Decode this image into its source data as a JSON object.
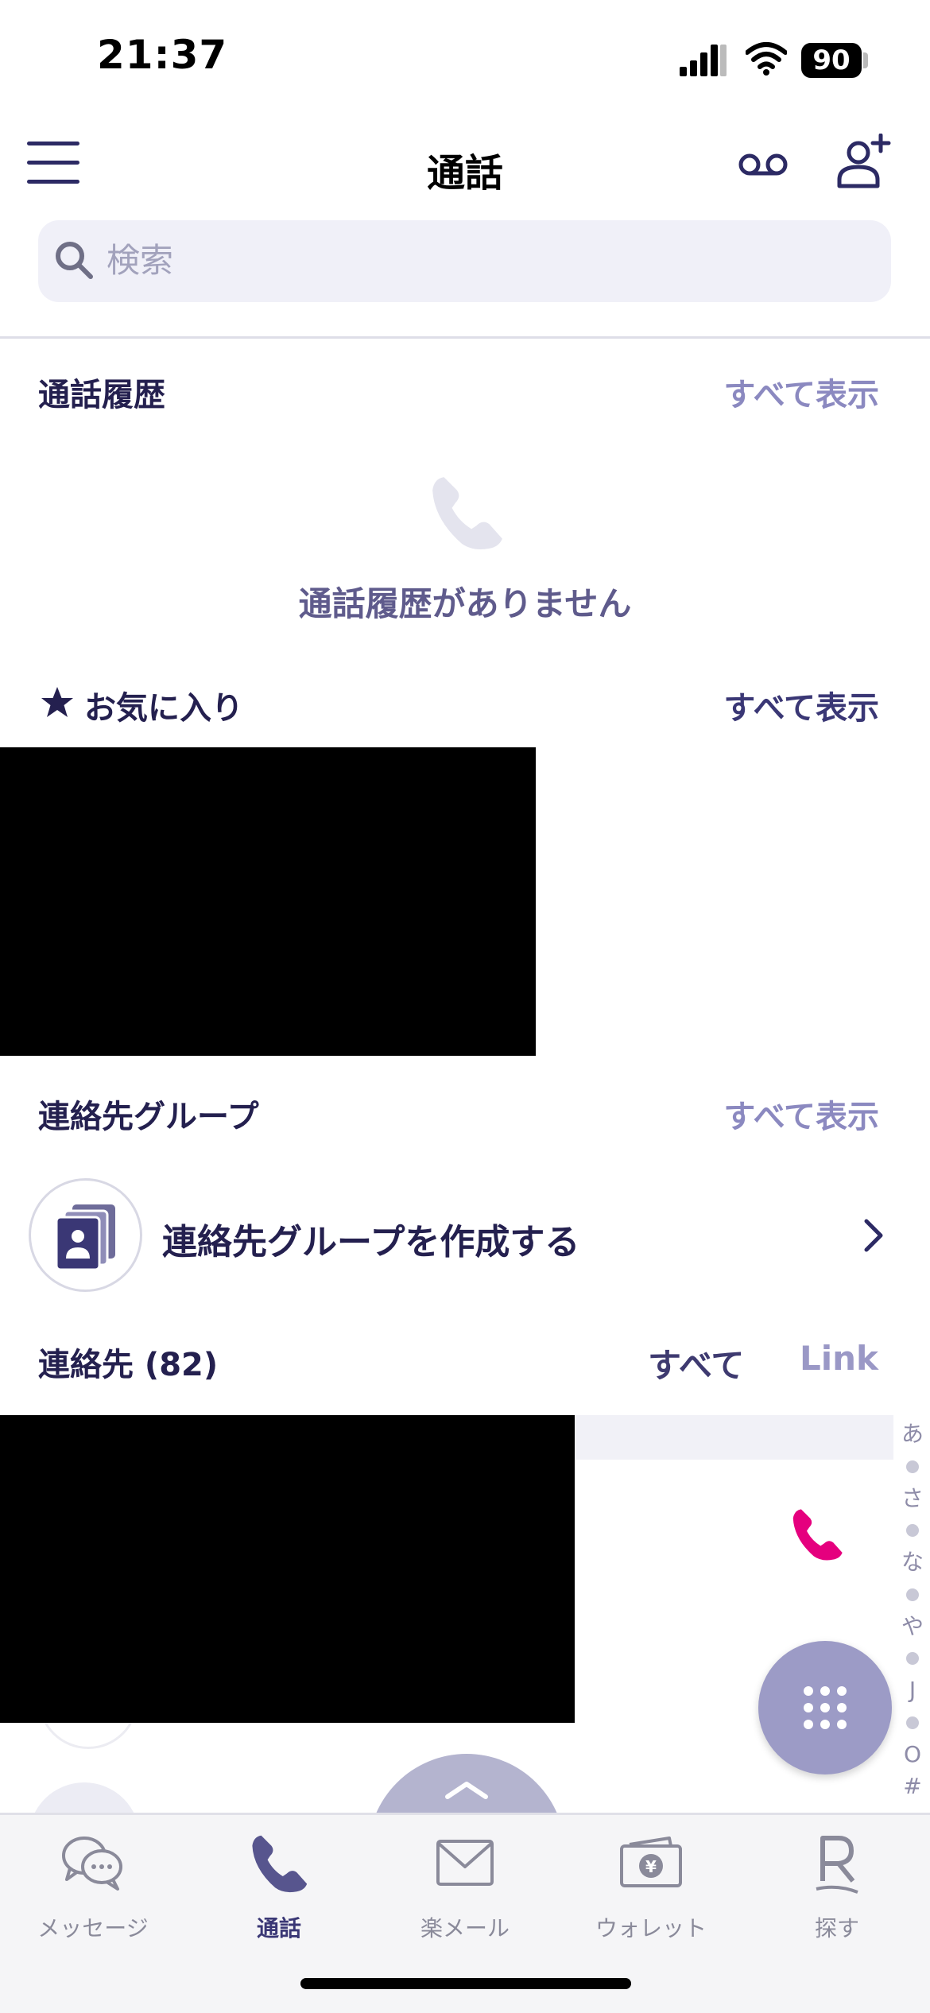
{
  "status_bar": {
    "time": "21:37",
    "battery": "90"
  },
  "header": {
    "title": "通話"
  },
  "search": {
    "placeholder": "検索"
  },
  "call_history": {
    "title": "通話履歴",
    "show_all": "すべて表示",
    "empty_message": "通話履歴がありません"
  },
  "favorites": {
    "title": "お気に入り",
    "show_all": "すべて表示"
  },
  "contact_groups": {
    "title": "連絡先グループ",
    "show_all": "すべて表示",
    "create_label": "連絡先グループを作成する"
  },
  "contacts": {
    "title": "連絡先 (82)",
    "tabs": [
      "すべて",
      "Link"
    ],
    "index": [
      "あ",
      "さ",
      "な",
      "や",
      "J",
      "O",
      "#"
    ]
  },
  "bottom_nav": {
    "items": [
      {
        "label": "メッセージ",
        "icon": "message-bubbles-icon",
        "active": false
      },
      {
        "label": "通話",
        "icon": "phone-icon",
        "active": true
      },
      {
        "label": "楽メール",
        "icon": "mail-icon",
        "active": false
      },
      {
        "label": "ウォレット",
        "icon": "wallet-icon",
        "active": false
      },
      {
        "label": "探す",
        "icon": "rakuten-r-icon",
        "active": false
      }
    ]
  },
  "colors": {
    "primary_dark": "#24204f",
    "accent_light": "#8b89c0",
    "call_pink": "#e5007e",
    "fab": "#9c9bc6"
  }
}
